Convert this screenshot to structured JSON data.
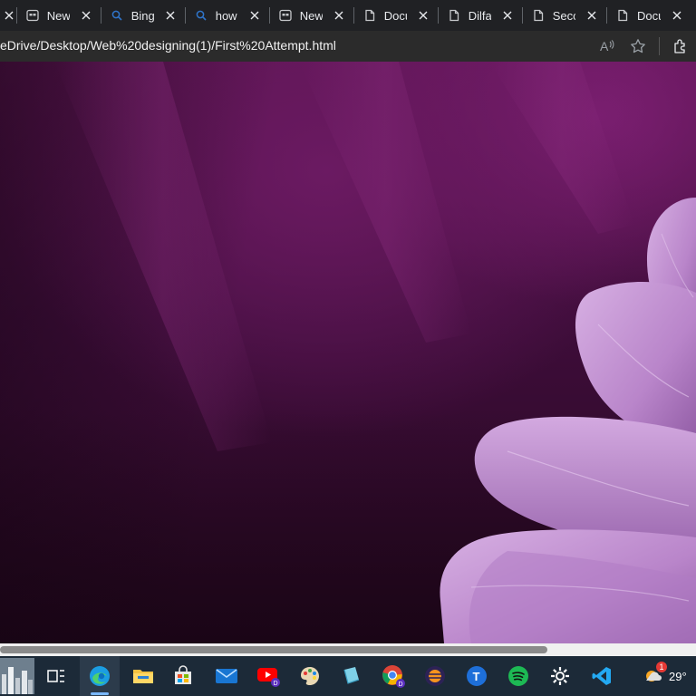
{
  "browser": {
    "tabs": [
      {
        "label": "",
        "icon": "close-icon"
      },
      {
        "label": "New t",
        "icon": "new-tab-icon"
      },
      {
        "label": "Bing",
        "icon": "search-icon"
      },
      {
        "label": "how t",
        "icon": "search-icon"
      },
      {
        "label": "New",
        "icon": "new-tab-icon"
      },
      {
        "label": "Docu",
        "icon": "document-icon"
      },
      {
        "label": "Dilfa",
        "icon": "document-icon"
      },
      {
        "label": "Secon",
        "icon": "document-icon"
      },
      {
        "label": "Docu",
        "icon": "document-icon"
      }
    ],
    "address": {
      "url": "eDrive/Desktop/Web%20designing(1)/First%20Attempt.html",
      "actions": [
        "read-aloud-icon",
        "favorite-star-icon",
        "extensions-icon"
      ]
    }
  },
  "page": {
    "background_colors": {
      "top": "#5c1452",
      "bottom": "#26081f",
      "petal": "#c99ad8"
    }
  },
  "scrollbar": {
    "horizontal_position_fraction": 0.79
  },
  "taskbar": {
    "apps": [
      {
        "name": "city-wallpaper-thumbnail"
      },
      {
        "name": "task-view-icon"
      },
      {
        "name": "edge-icon",
        "active": true
      },
      {
        "name": "file-explorer-icon"
      },
      {
        "name": "microsoft-store-icon"
      },
      {
        "name": "mail-icon"
      },
      {
        "name": "youtube-app-icon"
      },
      {
        "name": "paint-icon"
      },
      {
        "name": "paint-3d-icon"
      },
      {
        "name": "chrome-icon"
      },
      {
        "name": "eclipse-icon"
      },
      {
        "name": "app-t-icon"
      },
      {
        "name": "spotify-icon"
      },
      {
        "name": "settings-icon"
      },
      {
        "name": "vscode-icon"
      }
    ],
    "weather": {
      "temperature": "29°",
      "badge": "1"
    }
  }
}
